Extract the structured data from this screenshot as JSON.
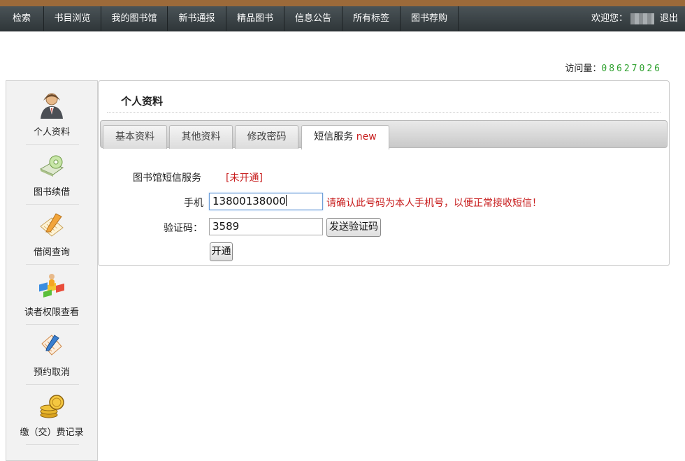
{
  "nav": {
    "items": [
      "检索",
      "书目浏览",
      "我的图书馆",
      "新书通报",
      "精品图书",
      "信息公告",
      "所有标签",
      "图书荐购"
    ],
    "welcome_label": "欢迎您：",
    "logout_label": "退出"
  },
  "visits": {
    "label": "访问量：",
    "count": "08627026"
  },
  "sidebar": {
    "items": [
      {
        "label": "个人资料",
        "icon": "user-icon"
      },
      {
        "label": "图书续借",
        "icon": "cd-book-icon"
      },
      {
        "label": "借阅查询",
        "icon": "notepad-pencil-icon"
      },
      {
        "label": "读者权限查看",
        "icon": "permissions-blocks-icon"
      },
      {
        "label": "预约取消",
        "icon": "clipboard-pen-icon"
      },
      {
        "label": "缴（交）费记录",
        "icon": "coins-icon"
      }
    ]
  },
  "panel": {
    "title": "个人资料",
    "tabs": [
      {
        "label": "基本资料"
      },
      {
        "label": "其他资料"
      },
      {
        "label": "修改密码"
      },
      {
        "label": "短信服务",
        "badge": "new"
      }
    ]
  },
  "sms_form": {
    "service_label": "图书馆短信服务",
    "service_status": "[未开通]",
    "phone_label": "手机",
    "phone_value": "13800138000",
    "phone_hint": "请确认此号码为本人手机号，以便正常接收短信！",
    "code_label": "验证码：",
    "code_value": "3589",
    "send_code_button": "发送验证码",
    "activate_button": "开通"
  },
  "colors": {
    "accent_red": "#c81e1e",
    "counter_green": "#2fa12f",
    "nav_bg": "#3a4346",
    "top_strip": "#9c6a3a"
  }
}
